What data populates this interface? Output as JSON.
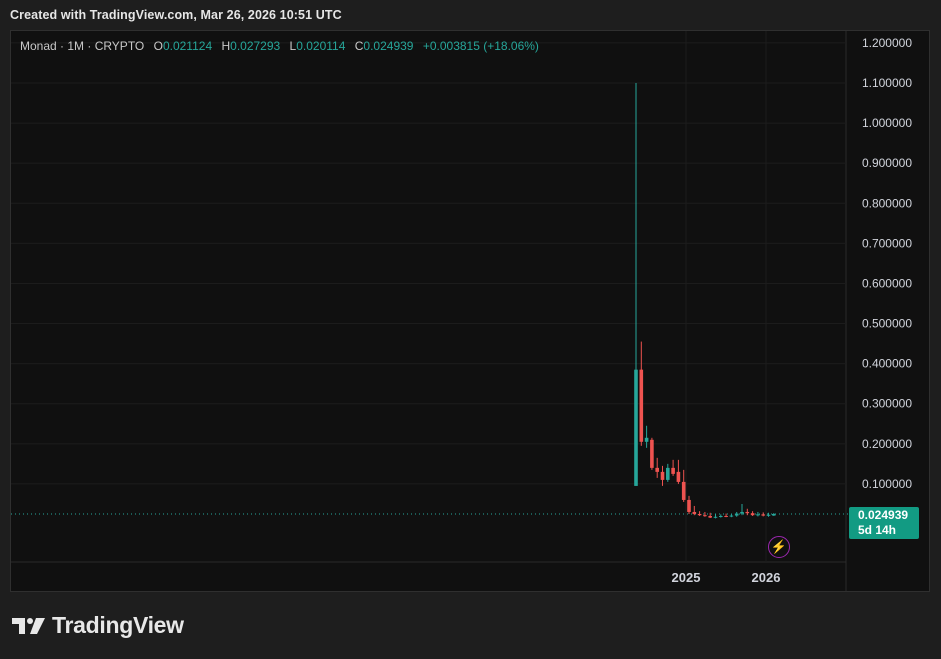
{
  "header": {
    "text": "Created with TradingView.com, Mar 26, 2026 10:51 UTC"
  },
  "legend": {
    "symbol": "Monad · 1M · CRYPTO",
    "o_label": "O",
    "o_value": "0.021124",
    "h_label": "H",
    "h_value": "0.027293",
    "l_label": "L",
    "l_value": "0.020114",
    "c_label": "C",
    "c_value": "0.024939",
    "change": "+0.003815 (+18.06%)"
  },
  "price_tag": {
    "value": "0.024939",
    "countdown": "5d 14h"
  },
  "brand": {
    "name": "TradingView"
  },
  "colors": {
    "up": "#26a69a",
    "down": "#ef5350",
    "background": "#101010",
    "axis_text": "#d1d4dc"
  },
  "icons": {
    "bolt": "lightning-bolt-icon",
    "logo": "tradingview-logo-icon"
  },
  "chart_data": {
    "type": "candlestick",
    "interval": "1M",
    "y_ticks": [
      "1.200000",
      "1.100000",
      "1.000000",
      "0.900000",
      "0.800000",
      "0.700000",
      "0.600000",
      "0.500000",
      "0.400000",
      "0.300000",
      "0.200000",
      "0.100000"
    ],
    "ylim": [
      -0.03,
      1.24
    ],
    "x_ticks": [
      "2025",
      "2026"
    ],
    "last_price": 0.024939,
    "candles": [
      {
        "o": 0.095,
        "h": 1.1,
        "l": 0.095,
        "c": 0.385
      },
      {
        "o": 0.385,
        "h": 0.455,
        "l": 0.195,
        "c": 0.205
      },
      {
        "o": 0.205,
        "h": 0.245,
        "l": 0.19,
        "c": 0.215
      },
      {
        "o": 0.21,
        "h": 0.215,
        "l": 0.135,
        "c": 0.14
      },
      {
        "o": 0.14,
        "h": 0.165,
        "l": 0.115,
        "c": 0.13
      },
      {
        "o": 0.13,
        "h": 0.145,
        "l": 0.095,
        "c": 0.11
      },
      {
        "o": 0.11,
        "h": 0.15,
        "l": 0.105,
        "c": 0.14
      },
      {
        "o": 0.14,
        "h": 0.16,
        "l": 0.12,
        "c": 0.125
      },
      {
        "o": 0.13,
        "h": 0.16,
        "l": 0.1,
        "c": 0.105
      },
      {
        "o": 0.105,
        "h": 0.135,
        "l": 0.055,
        "c": 0.06
      },
      {
        "o": 0.06,
        "h": 0.07,
        "l": 0.025,
        "c": 0.03
      },
      {
        "o": 0.03,
        "h": 0.045,
        "l": 0.022,
        "c": 0.025
      },
      {
        "o": 0.025,
        "h": 0.032,
        "l": 0.02,
        "c": 0.022
      },
      {
        "o": 0.022,
        "h": 0.03,
        "l": 0.018,
        "c": 0.02
      },
      {
        "o": 0.02,
        "h": 0.028,
        "l": 0.015,
        "c": 0.016
      },
      {
        "o": 0.016,
        "h": 0.024,
        "l": 0.014,
        "c": 0.018
      },
      {
        "o": 0.018,
        "h": 0.024,
        "l": 0.016,
        "c": 0.02
      },
      {
        "o": 0.02,
        "h": 0.026,
        "l": 0.017,
        "c": 0.019
      },
      {
        "o": 0.019,
        "h": 0.025,
        "l": 0.017,
        "c": 0.021
      },
      {
        "o": 0.021,
        "h": 0.03,
        "l": 0.018,
        "c": 0.026
      },
      {
        "o": 0.026,
        "h": 0.05,
        "l": 0.022,
        "c": 0.03
      },
      {
        "o": 0.03,
        "h": 0.038,
        "l": 0.022,
        "c": 0.027
      },
      {
        "o": 0.027,
        "h": 0.032,
        "l": 0.02,
        "c": 0.022
      },
      {
        "o": 0.022,
        "h": 0.03,
        "l": 0.019,
        "c": 0.024
      },
      {
        "o": 0.024,
        "h": 0.029,
        "l": 0.019,
        "c": 0.021
      },
      {
        "o": 0.021,
        "h": 0.028,
        "l": 0.018,
        "c": 0.023
      },
      {
        "o": 0.021124,
        "h": 0.027293,
        "l": 0.020114,
        "c": 0.024939
      }
    ]
  }
}
